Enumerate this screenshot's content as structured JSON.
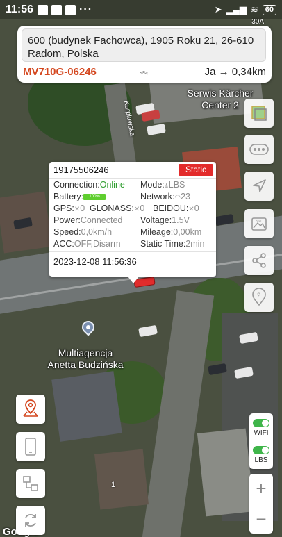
{
  "status_bar": {
    "time": "11:56",
    "dots": "···",
    "battery": "60",
    "carrier_tag": "30A"
  },
  "address_card": {
    "address": "600 (budynek Fachowca), 1905 Roku 21, 26-610 Radom, Polska",
    "device_name": "MV710G-06246",
    "distance": "Ja → 0,34km"
  },
  "map": {
    "label_top": "Serwis Kärcher Center 2",
    "label_left_1": "Multiagencja",
    "label_left_2": "Anetta Budzińska",
    "street": "Kurpiowska",
    "google": "Google",
    "lot_number": "1"
  },
  "popup": {
    "imei": "19175506246",
    "status": "Static",
    "connection_label": "Connection:",
    "connection_value": "Online",
    "mode_label": "Mode:",
    "mode_value": "LBS",
    "battery_label": "Battery:",
    "battery_value": "100%",
    "network_label": "Network:",
    "network_value": "23",
    "gps_label": "GPS:",
    "gps_value": "0",
    "glonass_label": "GLONASS:",
    "glonass_value": "0",
    "beidou_label": "BEIDOU:",
    "beidou_value": "0",
    "power_label": "Power:",
    "power_value": "Connected",
    "voltage_label": "Voltage:",
    "voltage_value": "1.5V",
    "speed_label": "Speed:",
    "speed_value": "0,0km/h",
    "mileage_label": "Mileage:",
    "mileage_value": "0,00km",
    "acc_label": "ACC:",
    "acc_value": "OFF,Disarm",
    "static_time_label": "Static Time:",
    "static_time_value": "2min",
    "timestamp": "2023-12-08 11:56:36"
  },
  "right_controls": {
    "wifi_label": "WIFI",
    "lbs_label": "LBS",
    "zoom_in": "+",
    "zoom_out": "−"
  },
  "colors": {
    "accent_red": "#d4471f",
    "static_badge": "#e32b2b",
    "online_green": "#2e9d2e",
    "toggle_green": "#3fb54a"
  },
  "icons": {
    "left": [
      "location-pin-icon",
      "phone-icon",
      "device-list-icon",
      "refresh-icon"
    ],
    "right": [
      "map-layers-icon",
      "more-icon",
      "navigate-icon",
      "street-view-icon",
      "share-icon",
      "geofence-icon"
    ]
  }
}
